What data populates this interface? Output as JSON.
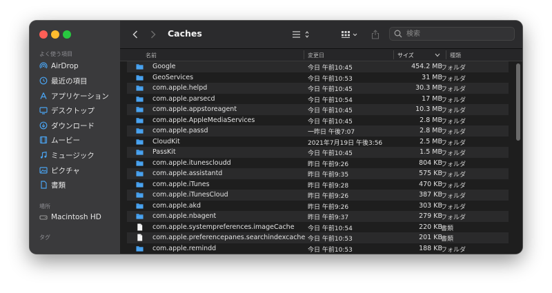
{
  "window": {
    "title": "Caches"
  },
  "colors": {
    "folder": "#4aa3f0",
    "accent": "#0a84ff"
  },
  "sidebar": {
    "favorites_label": "よく使う項目",
    "locations_label": "場所",
    "tags_label": "タグ",
    "favorites": [
      {
        "label": "AirDrop",
        "icon": "airdrop-icon"
      },
      {
        "label": "最近の項目",
        "icon": "clock-icon"
      },
      {
        "label": "アプリケーション",
        "icon": "applications-icon"
      },
      {
        "label": "デスクトップ",
        "icon": "desktop-icon"
      },
      {
        "label": "ダウンロード",
        "icon": "download-icon"
      },
      {
        "label": "ムービー",
        "icon": "film-icon"
      },
      {
        "label": "ミュージック",
        "icon": "music-icon"
      },
      {
        "label": "ピクチャ",
        "icon": "photo-icon"
      },
      {
        "label": "書類",
        "icon": "document-icon"
      }
    ],
    "locations": [
      {
        "label": "Macintosh HD",
        "icon": "disk-icon"
      }
    ]
  },
  "search": {
    "placeholder": "検索"
  },
  "columns": {
    "name": "名前",
    "date": "変更日",
    "size": "サイズ",
    "kind": "種類"
  },
  "files": [
    {
      "name": "Google",
      "date": "今日 午前10:45",
      "size": "454.2 MB",
      "kind": "フォルダ",
      "type": "folder"
    },
    {
      "name": "GeoServices",
      "date": "今日 午前10:53",
      "size": "31 MB",
      "kind": "フォルダ",
      "type": "folder"
    },
    {
      "name": "com.apple.helpd",
      "date": "今日 午前10:45",
      "size": "30.3 MB",
      "kind": "フォルダ",
      "type": "folder"
    },
    {
      "name": "com.apple.parsecd",
      "date": "今日 午前10:54",
      "size": "17 MB",
      "kind": "フォルダ",
      "type": "folder"
    },
    {
      "name": "com.apple.appstoreagent",
      "date": "今日 午前10:45",
      "size": "10.3 MB",
      "kind": "フォルダ",
      "type": "folder"
    },
    {
      "name": "com.apple.AppleMediaServices",
      "date": "今日 午前10:45",
      "size": "2.8 MB",
      "kind": "フォルダ",
      "type": "folder"
    },
    {
      "name": "com.apple.passd",
      "date": "一昨日 午後7:07",
      "size": "2.8 MB",
      "kind": "フォルダ",
      "type": "folder"
    },
    {
      "name": "CloudKit",
      "date": "2021年7月19日 午後3:56",
      "size": "2.5 MB",
      "kind": "フォルダ",
      "type": "folder"
    },
    {
      "name": "PassKit",
      "date": "今日 午前10:45",
      "size": "1.5 MB",
      "kind": "フォルダ",
      "type": "folder"
    },
    {
      "name": "com.apple.itunescloudd",
      "date": "昨日 午前9:26",
      "size": "804 KB",
      "kind": "フォルダ",
      "type": "folder"
    },
    {
      "name": "com.apple.assistantd",
      "date": "昨日 午前9:35",
      "size": "575 KB",
      "kind": "フォルダ",
      "type": "folder"
    },
    {
      "name": "com.apple.iTunes",
      "date": "昨日 午前9:28",
      "size": "470 KB",
      "kind": "フォルダ",
      "type": "folder"
    },
    {
      "name": "com.apple.iTunesCloud",
      "date": "昨日 午前9:26",
      "size": "387 KB",
      "kind": "フォルダ",
      "type": "folder"
    },
    {
      "name": "com.apple.akd",
      "date": "昨日 午前9:26",
      "size": "303 KB",
      "kind": "フォルダ",
      "type": "folder"
    },
    {
      "name": "com.apple.nbagent",
      "date": "昨日 午前9:37",
      "size": "279 KB",
      "kind": "フォルダ",
      "type": "folder"
    },
    {
      "name": "com.apple.systempreferences.imageCache",
      "date": "今日 午前10:54",
      "size": "220 KB",
      "kind": "書類",
      "type": "file"
    },
    {
      "name": "com.apple.preferencepanes.searchindexcache",
      "date": "今日 午前10:53",
      "size": "201 KB",
      "kind": "書類",
      "type": "file"
    },
    {
      "name": "com.apple.remindd",
      "date": "今日 午前10:53",
      "size": "188 KB",
      "kind": "フォルダ",
      "type": "folder"
    }
  ]
}
